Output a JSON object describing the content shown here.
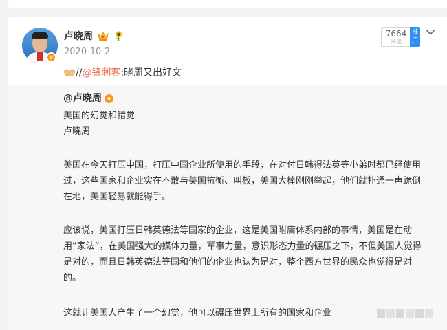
{
  "post": {
    "username": "卢晓周",
    "date": "2020-10-2",
    "verified_badge": "v",
    "reads": {
      "count": "7664",
      "label": "阅读",
      "promote_label": "推广"
    },
    "repost": {
      "prefix": "//",
      "mention": "@锋刺客",
      "text": ":晓周又出好文"
    },
    "icons": [
      "crown-icon",
      "sunflower-icon",
      "handshake-icon",
      "chevron-down-icon"
    ]
  },
  "quoted": {
    "author": "@卢晓周",
    "title": "美国的幻觉和错觉",
    "byline": "卢晓周",
    "paragraphs": [
      "美国在今天打压中国，打压中国企业所使用的手段，在对付日韩得法英等小弟时都已经使用过，这些国家和企业实在不敢与美国抗衡、叫板，美国大棒刚刚举起，他们就扑通一声跪倒在地，美国轻易就能得手。",
      "应该说，美国打压日韩英德法等国家的企业，这是美国附庸体系内部的事情，美国是在动用“家法”，在美国强大的媒体力量，军事力量，意识形态力量的碾压之下，不但美国人觉得是对的，而且日韩英德法等国和他们的企业也认为是对，整个西方世界的民众也觉得是对的。",
      "这就让美国人产生了一个幻觉，他可以碾压世界上所有的国家和企业"
    ]
  },
  "colors": {
    "accent_orange": "#eb7350",
    "badge_orange": "#f79a16",
    "promote_blue": "#2f8ff3",
    "background": "#f2f2f5",
    "quote_bg": "#f7f7f7"
  }
}
